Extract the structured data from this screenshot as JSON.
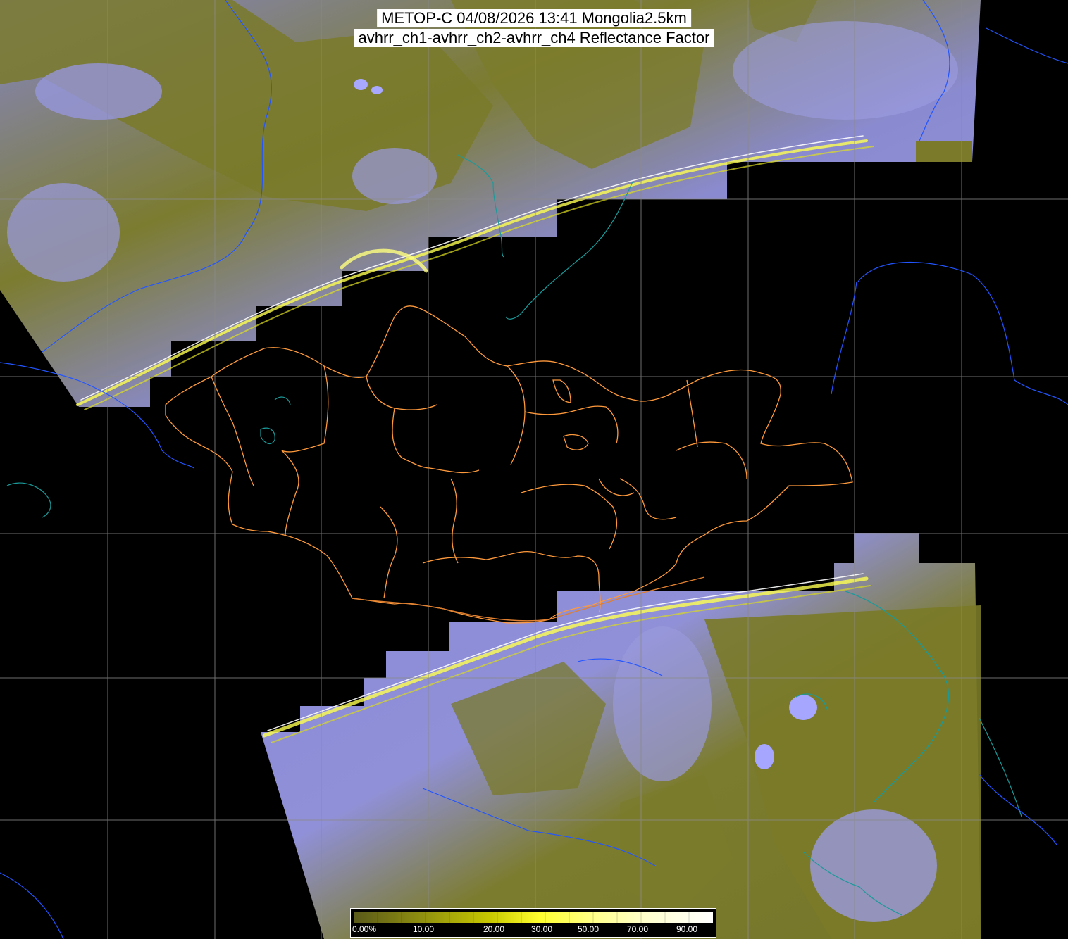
{
  "header": {
    "title_line1": "METOP-C 04/08/2026 13:41 Mongolia2.5km",
    "title_line2": "avhrr_ch1-avhrr_ch2-avhrr_ch4 Reflectance Factor"
  },
  "colorbar": {
    "labels": [
      "0.00%",
      "10.00",
      "20.00",
      "30.00",
      "50.00",
      "70.00",
      "90.00"
    ],
    "colors": [
      "#5a5a1a",
      "#8c8c10",
      "#c8c800",
      "#ffff40",
      "#ffff90",
      "#ffffd0",
      "#ffffff"
    ]
  },
  "colors": {
    "background": "#000000",
    "land_olive": "#7a7a28",
    "cloud_lavender": "#8a8ad8",
    "admin_boundary": "#ff9a3c",
    "river": "#2255ff",
    "coast": "#1a9a9a",
    "grid": "#8a8a8a"
  }
}
